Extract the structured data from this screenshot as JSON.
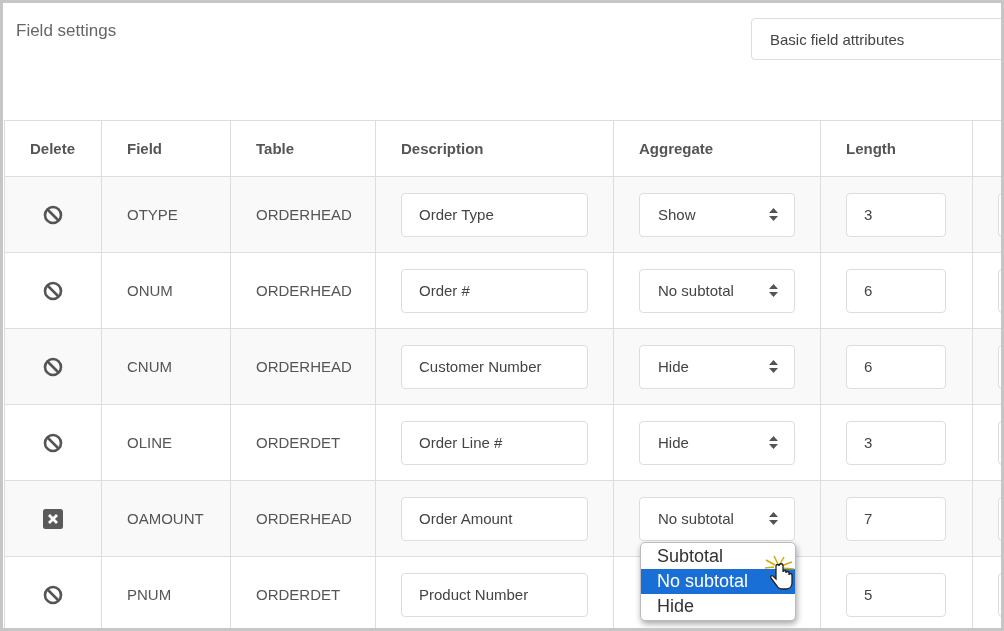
{
  "title": "Field settings",
  "view_select": {
    "value": "Basic field attributes"
  },
  "table": {
    "columns": [
      "Delete",
      "Field",
      "Table",
      "Description",
      "Aggregate",
      "Length"
    ],
    "rows": [
      {
        "delete_hover": false,
        "field": "OTYPE",
        "table": "ORDERHEAD",
        "description": "Order Type",
        "aggregate": {
          "value": "Show"
        },
        "length": "3"
      },
      {
        "delete_hover": false,
        "field": "ONUM",
        "table": "ORDERHEAD",
        "description": "Order #",
        "aggregate": {
          "value": "No subtotal"
        },
        "length": "6"
      },
      {
        "delete_hover": false,
        "field": "CNUM",
        "table": "ORDERHEAD",
        "description": "Customer Number",
        "aggregate": {
          "value": "Hide"
        },
        "length": "6"
      },
      {
        "delete_hover": false,
        "field": "OLINE",
        "table": "ORDERDET",
        "description": "Order Line #",
        "aggregate": {
          "value": "Hide"
        },
        "length": "3"
      },
      {
        "delete_hover": true,
        "field": "OAMOUNT",
        "table": "ORDERHEAD",
        "description": "Order Amount",
        "aggregate": {
          "value": "No subtotal",
          "options": [
            {
              "label": "Subtotal",
              "selected": false
            },
            {
              "label": "No subtotal",
              "selected": true
            },
            {
              "label": "Hide",
              "selected": false
            }
          ]
        },
        "length": "7"
      },
      {
        "delete_hover": false,
        "field": "PNUM",
        "table": "ORDERDET",
        "description": "Product Number",
        "aggregate": {},
        "length": "5"
      }
    ]
  }
}
